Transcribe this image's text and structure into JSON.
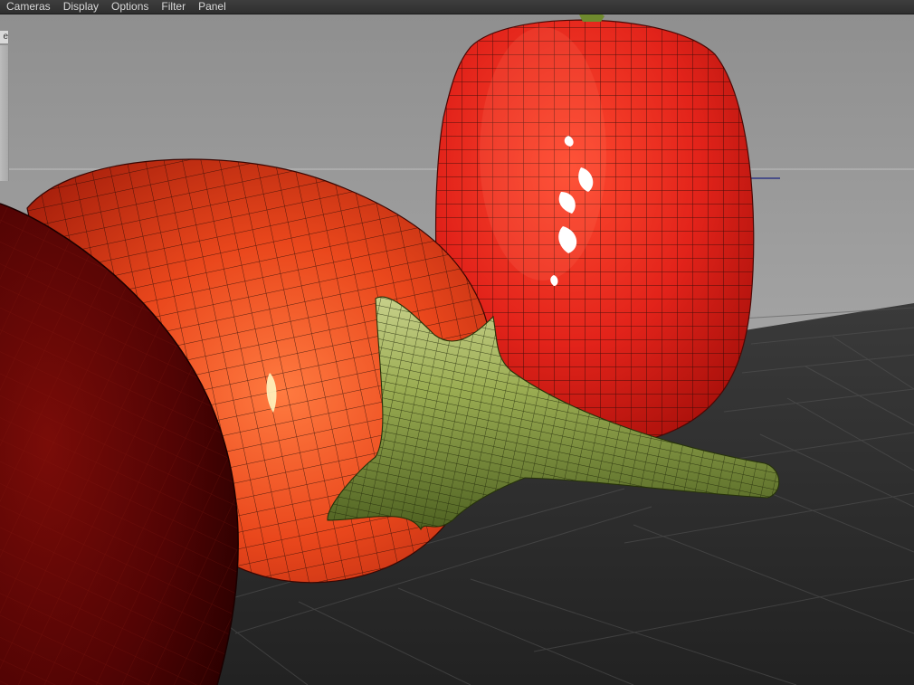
{
  "menubar": {
    "items": [
      {
        "label": "Cameras"
      },
      {
        "label": "Display"
      },
      {
        "label": "Options"
      },
      {
        "label": "Filter"
      },
      {
        "label": "Panel"
      }
    ]
  },
  "viewport": {
    "side_tab_label": "e",
    "objects": [
      {
        "name": "tall red pepper",
        "color": "#e0261a"
      },
      {
        "name": "round red eggplant",
        "color": "#e84a1c"
      },
      {
        "name": "eggplant stem",
        "color": "#7f9a3a"
      },
      {
        "name": "foreground dark red vegetable",
        "color": "#5a0606"
      }
    ],
    "colors": {
      "background": "#a3a3a3",
      "ground_plane": "#2a2a2a",
      "wireframe": "#1a0a06"
    }
  }
}
